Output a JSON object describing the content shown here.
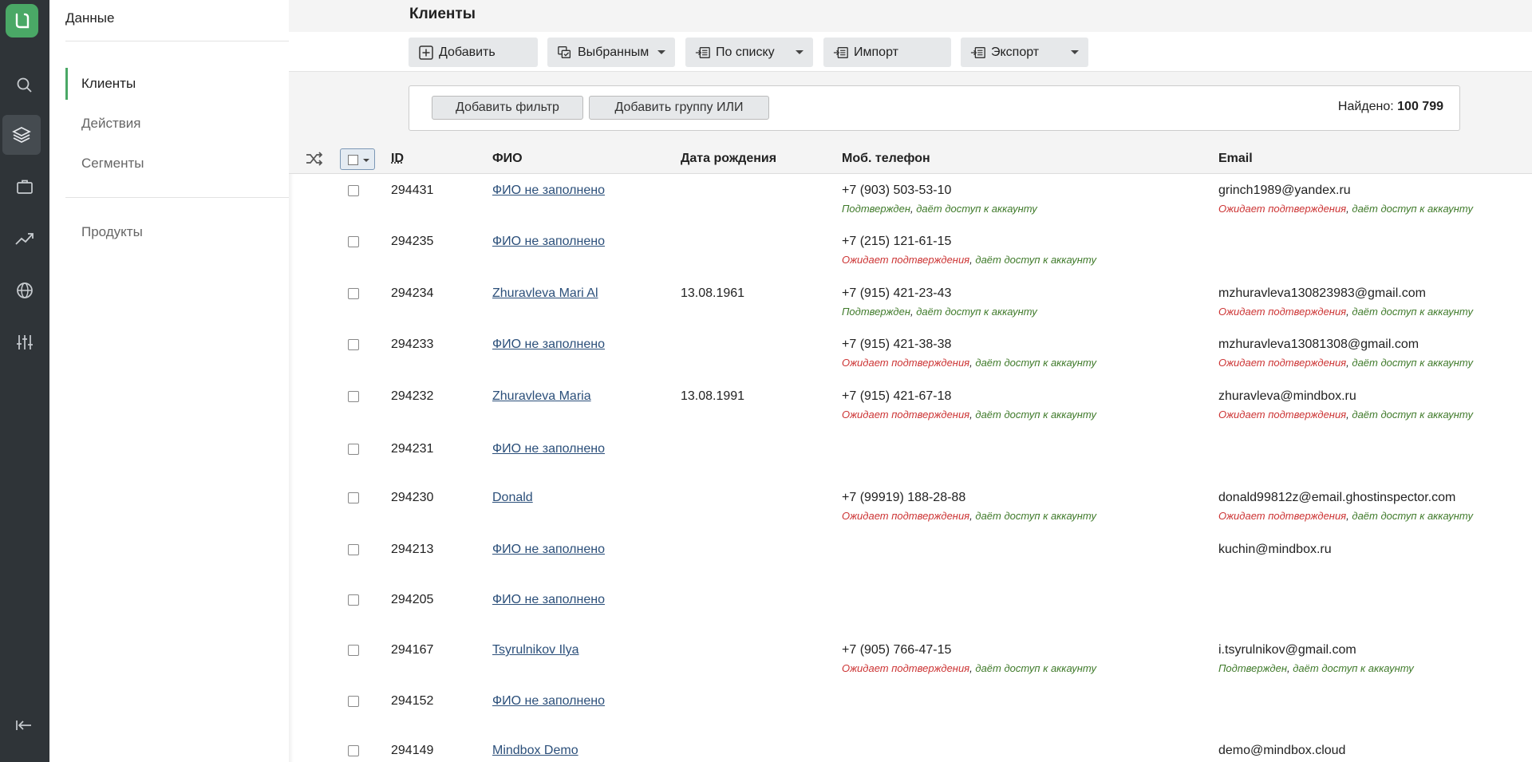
{
  "sidebar": {
    "title": "Данные",
    "items": [
      {
        "label": "Клиенты"
      },
      {
        "label": "Действия"
      },
      {
        "label": "Сегменты"
      },
      {
        "label": "Продукты"
      }
    ]
  },
  "header": {
    "title": "Клиенты"
  },
  "toolbar": {
    "add": "Добавить",
    "selected": "Выбранным",
    "by_list": "По списку",
    "import": "Импорт",
    "export": "Экспорт"
  },
  "filter": {
    "add_filter": "Добавить фильтр",
    "add_group": "Добавить группу ИЛИ",
    "found_label": "Найдено:",
    "found_count": "100 799"
  },
  "columns": {
    "id": "ID",
    "name": "ФИО",
    "birth": "Дата рождения",
    "phone": "Моб. телефон",
    "email": "Email"
  },
  "status": {
    "confirmed": "Подтвержден",
    "pending": "Ожидает подтверждения",
    "sep": ",",
    "access": " даёт доступ к аккаунту"
  },
  "rows": [
    {
      "id": "294431",
      "name": "ФИО не заполнено",
      "birth": "",
      "phone": "+7 (903) 503-53-10",
      "phone_status": "Подтвержден",
      "email": "grinch1989@yandex.ru",
      "email_status": "Ожидает подтверждения"
    },
    {
      "id": "294235",
      "name": "ФИО не заполнено",
      "birth": "",
      "phone": "+7 (215) 121-61-15",
      "phone_status": "Ожидает подтверждения",
      "email": "",
      "email_status": ""
    },
    {
      "id": "294234",
      "name": "Zhuravleva Mari Al",
      "birth": "13.08.1961",
      "phone": "+7 (915) 421-23-43",
      "phone_status": "Подтвержден",
      "email": "mzhuravleva130823983@gmail.com",
      "email_status": "Ожидает подтверждения"
    },
    {
      "id": "294233",
      "name": "ФИО не заполнено",
      "birth": "",
      "phone": "+7 (915) 421-38-38",
      "phone_status": "Ожидает подтверждения",
      "email": "mzhuravleva13081308@gmail.com",
      "email_status": "Ожидает подтверждения"
    },
    {
      "id": "294232",
      "name": "Zhuravleva Maria",
      "birth": "13.08.1991",
      "phone": "+7 (915) 421-67-18",
      "phone_status": "Ожидает подтверждения",
      "email": "zhuravleva@mindbox.ru",
      "email_status": "Ожидает подтверждения"
    },
    {
      "id": "294231",
      "name": "ФИО не заполнено",
      "birth": "",
      "phone": "",
      "phone_status": "",
      "email": "",
      "email_status": ""
    },
    {
      "id": "294230",
      "name": "Donald",
      "birth": "",
      "phone": "+7 (99919) 188-28-88",
      "phone_status": "Ожидает подтверждения",
      "email": "donald99812z@email.ghostinspector.com",
      "email_status": "Ожидает подтверждения"
    },
    {
      "id": "294213",
      "name": "ФИО не заполнено",
      "birth": "",
      "phone": "",
      "phone_status": "",
      "email": "kuchin@mindbox.ru",
      "email_status": ""
    },
    {
      "id": "294205",
      "name": "ФИО не заполнено",
      "birth": "",
      "phone": "",
      "phone_status": "",
      "email": "",
      "email_status": ""
    },
    {
      "id": "294167",
      "name": "Tsyrulnikov Ilya",
      "birth": "",
      "phone": "+7 (905) 766-47-15",
      "phone_status": "Ожидает подтверждения",
      "email": "i.tsyrulnikov@gmail.com",
      "email_status": "Подтвержден"
    },
    {
      "id": "294152",
      "name": "ФИО не заполнено",
      "birth": "",
      "phone": "",
      "phone_status": "",
      "email": "",
      "email_status": ""
    },
    {
      "id": "294149",
      "name": "Mindbox Demo",
      "birth": "",
      "phone": "",
      "phone_status": "",
      "email": "demo@mindbox.cloud",
      "email_status": ""
    }
  ],
  "colors": {
    "accent": "#4aa866",
    "rail": "#2f3438",
    "link": "#2b4f7a",
    "pending": "#cc3333",
    "confirmed": "#3f7a2a"
  }
}
